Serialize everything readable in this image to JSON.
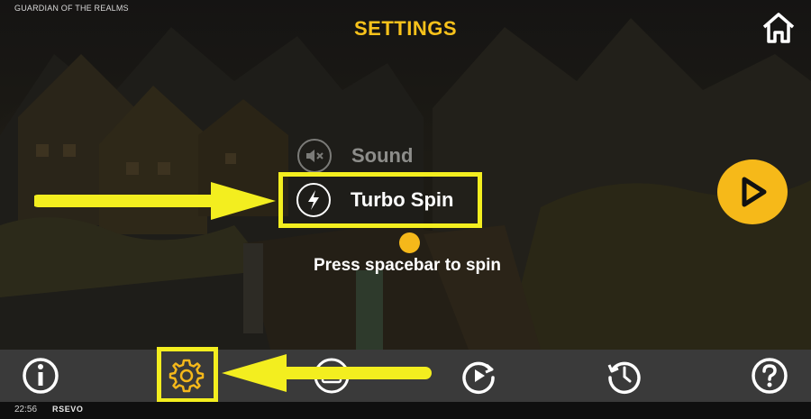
{
  "game": {
    "title": "GUARDIAN OF THE REALMS"
  },
  "header": {
    "title": "SETTINGS",
    "home_icon": "home-icon"
  },
  "settings": {
    "sound": {
      "label": "Sound",
      "icon": "sound-off-icon",
      "enabled": false
    },
    "turbo_spin": {
      "label": "Turbo Spin",
      "icon": "lightning-icon",
      "enabled": true
    },
    "hint": "Press spacebar to spin"
  },
  "play": {
    "icon": "play-icon"
  },
  "toolbar": {
    "items": [
      {
        "icon": "info-icon"
      },
      {
        "icon": "gear-icon",
        "highlighted": true
      },
      {
        "icon": "paytable-icon"
      },
      {
        "icon": "autoplay-icon"
      },
      {
        "icon": "history-icon"
      },
      {
        "icon": "help-icon"
      }
    ]
  },
  "status_bar": {
    "time": "22:56",
    "brand": "RSEVO"
  },
  "colors": {
    "accent": "#f8c21b",
    "highlight": "#f3ee1f",
    "toolbar": "#3a3a3a"
  }
}
